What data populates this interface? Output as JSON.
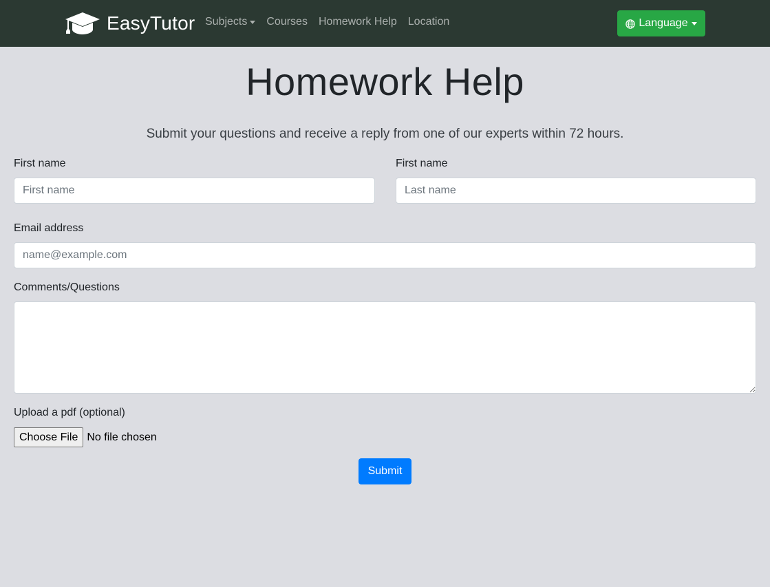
{
  "navbar": {
    "brand": "EasyTutor",
    "brand_icon": "graduation-cap-icon",
    "links": [
      {
        "label": "Subjects",
        "dropdown": true
      },
      {
        "label": "Courses",
        "dropdown": false
      },
      {
        "label": "Homework Help",
        "dropdown": false
      },
      {
        "label": "Location",
        "dropdown": false
      }
    ],
    "language_button": {
      "label": "Language",
      "icon": "globe-icon"
    }
  },
  "main": {
    "title": "Homework Help",
    "lead": "Submit your questions and receive a reply from one of our experts within 72 hours."
  },
  "form": {
    "first_name": {
      "label": "First name",
      "placeholder": "First name",
      "value": ""
    },
    "last_name": {
      "label": "First name",
      "placeholder": "Last name",
      "value": ""
    },
    "email": {
      "label": "Email address",
      "placeholder": "name@example.com",
      "value": ""
    },
    "comments": {
      "label": "Comments/Questions",
      "value": ""
    },
    "upload": {
      "label": "Upload a pdf (optional)",
      "button": "Choose File",
      "status": "No file chosen"
    },
    "submit": "Submit"
  },
  "colors": {
    "navbar_bg": "#2b3932",
    "page_bg": "#dcdde2",
    "language_button": "#28a745",
    "submit_button": "#007bff"
  }
}
